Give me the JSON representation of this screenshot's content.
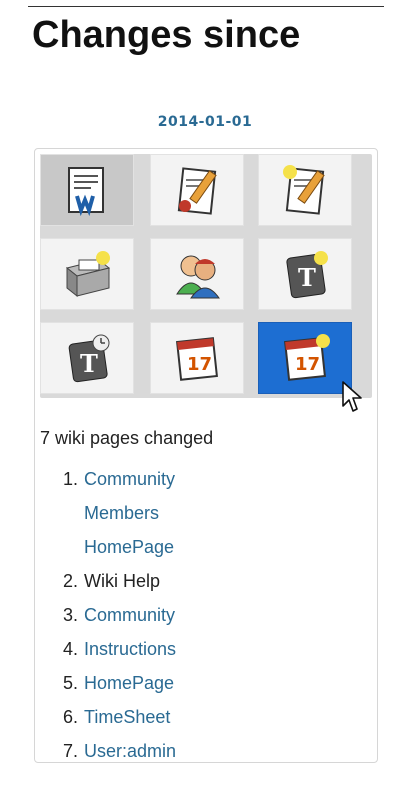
{
  "header": {
    "title": "Changes since"
  },
  "date": "2014-01-01",
  "toolbar": {
    "icons": [
      {
        "name": "wiki-page-icon",
        "pressed": true
      },
      {
        "name": "edit-page-icon"
      },
      {
        "name": "new-page-icon"
      },
      {
        "name": "file-cabinet-icon"
      },
      {
        "name": "users-icon"
      },
      {
        "name": "timesheet-icon"
      },
      {
        "name": "timesheet-clock-icon"
      },
      {
        "name": "calendar-icon"
      },
      {
        "name": "new-calendar-icon",
        "selected": true
      }
    ],
    "calendar_day": "17",
    "timesheet_letter": "T"
  },
  "summary": "7 wiki pages changed",
  "changes": [
    {
      "num": "1.",
      "lines": [
        "Community",
        "Members",
        "HomePage"
      ],
      "link": true
    },
    {
      "num": "2.",
      "lines": [
        "Wiki Help"
      ],
      "link": false
    },
    {
      "num": "3.",
      "lines": [
        "Community"
      ],
      "link": true
    },
    {
      "num": "4.",
      "lines": [
        "Instructions"
      ],
      "link": true
    },
    {
      "num": "5.",
      "lines": [
        "HomePage"
      ],
      "link": true
    },
    {
      "num": "6.",
      "lines": [
        "TimeSheet"
      ],
      "link": true
    },
    {
      "num": "7.",
      "lines": [
        "User:admin"
      ],
      "link": true
    }
  ],
  "colors": {
    "link": "#2a6a93",
    "selected_tile": "#1d6ed2"
  }
}
